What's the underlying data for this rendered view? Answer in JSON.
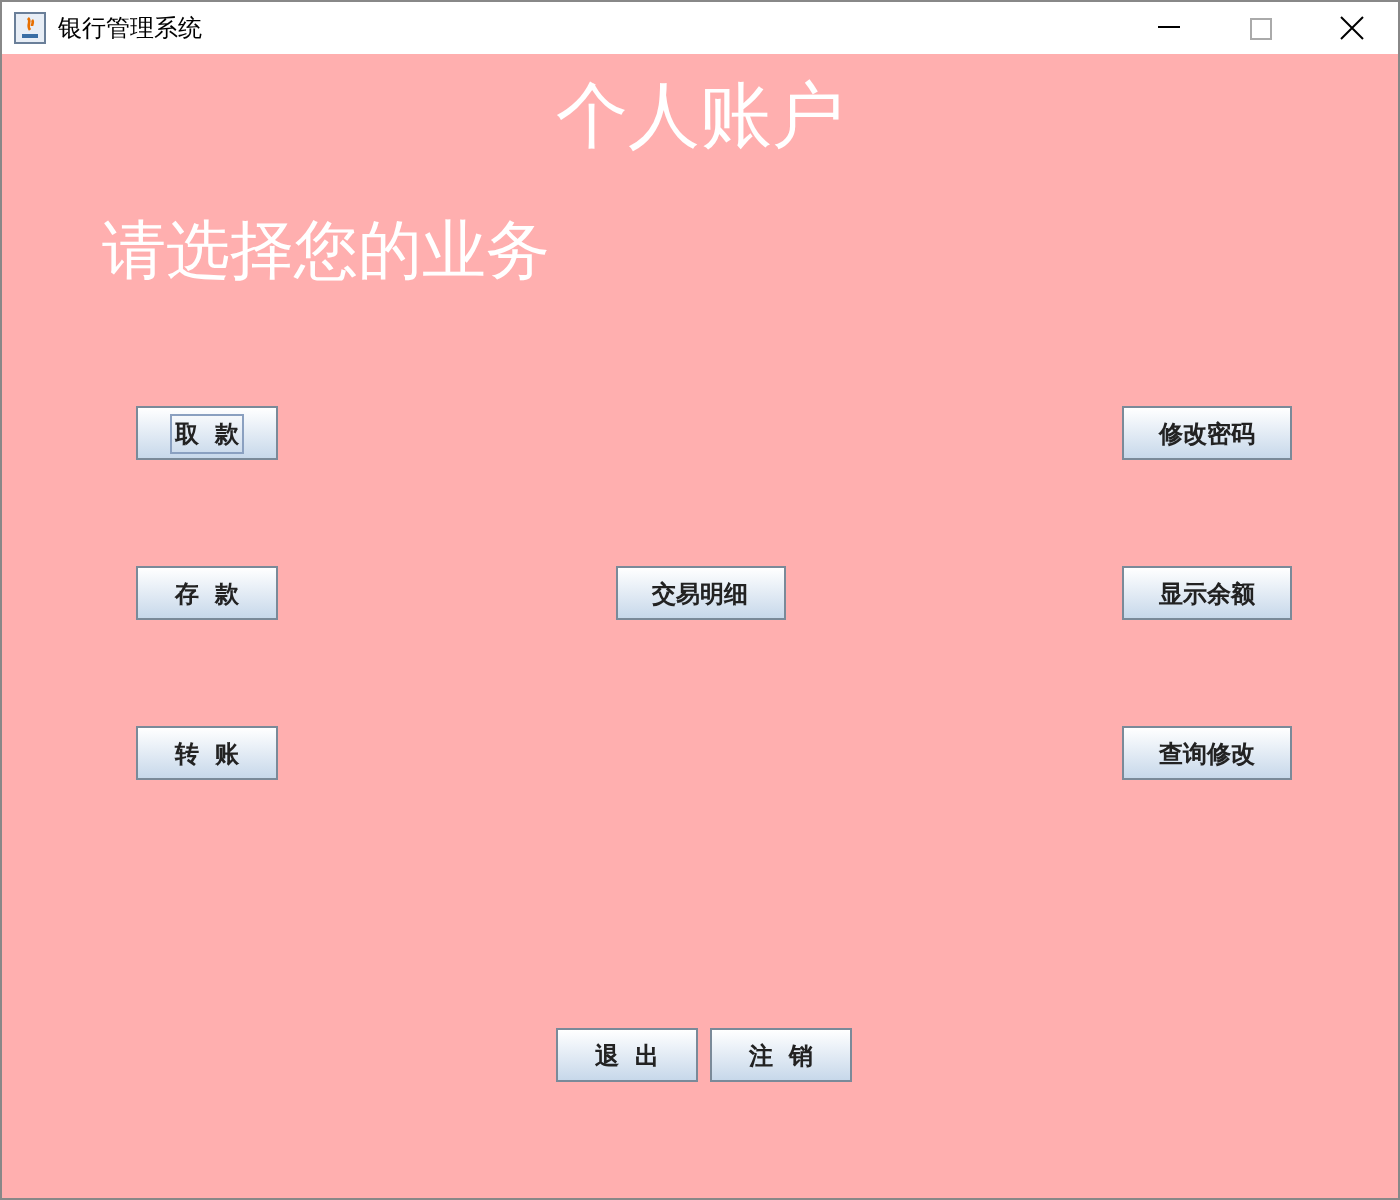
{
  "window": {
    "title": "银行管理系统"
  },
  "heading": "个人账户",
  "prompt": "请选择您的业务",
  "rows": [
    {
      "left": {
        "label": "取  款",
        "focused": true
      },
      "right": {
        "label": "修改密码",
        "focused": false
      }
    },
    {
      "left": {
        "label": "存  款",
        "focused": false
      },
      "middle": {
        "label": "交易明细",
        "focused": false
      },
      "right": {
        "label": "显示余额",
        "focused": false
      }
    },
    {
      "left": {
        "label": "转  账",
        "focused": false
      },
      "right": {
        "label": "查询修改",
        "focused": false
      }
    }
  ],
  "bottom_buttons": [
    {
      "label": "退  出",
      "focused": false
    },
    {
      "label": "注  销",
      "focused": false
    }
  ]
}
